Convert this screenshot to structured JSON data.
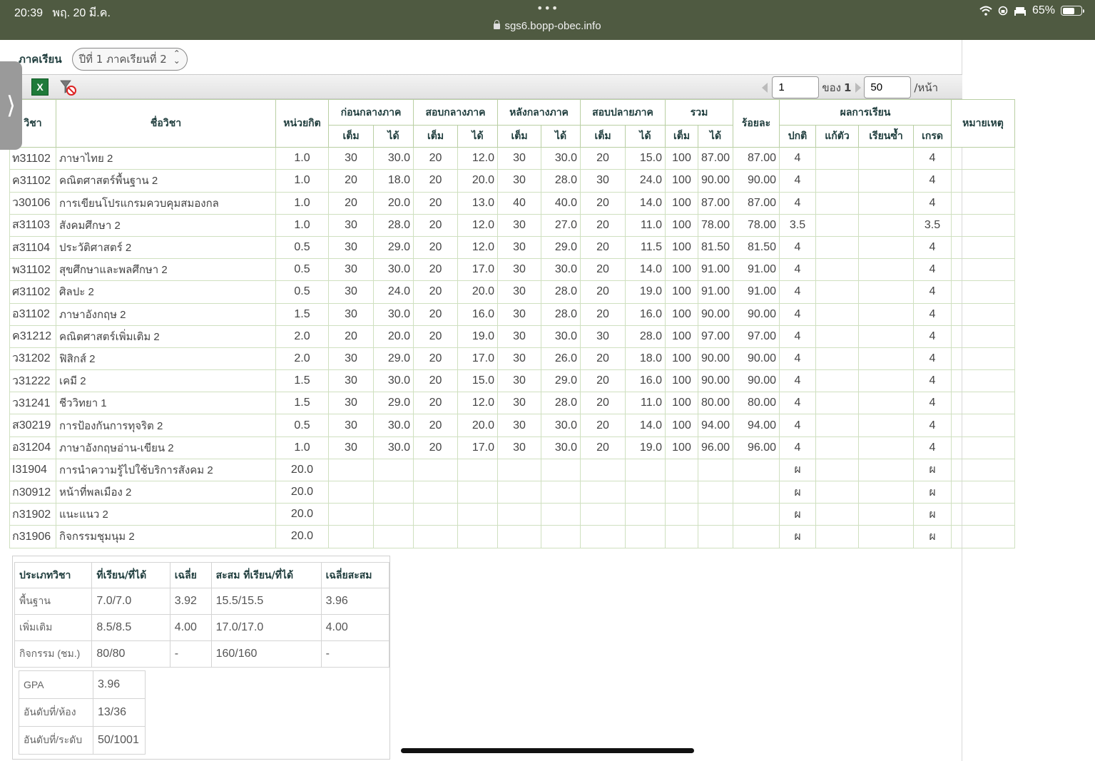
{
  "status_bar": {
    "time": "20:39",
    "date": "พฤ. 20 มี.ค.",
    "dots": "•••",
    "url": "sgs6.bopp-obec.info",
    "battery": "65%",
    "icons": [
      "wifi-icon",
      "rotation-lock-icon",
      "sleep-icon",
      "battery-icon"
    ]
  },
  "side_tab": {
    "glyph": "⟩"
  },
  "term": {
    "label": "ภาคเรียน",
    "selected": "ปีที่ 1 ภาคเรียนที่ 2"
  },
  "toolbar": {
    "excel_icon": "X",
    "pager": {
      "page": "1",
      "of_label": "ของ",
      "total_pages": "1",
      "per_page": "50",
      "per_page_label": "/หน้า"
    }
  },
  "table": {
    "headers": {
      "code": "วิชา",
      "name": "ชื่อวิชา",
      "credit": "หน่วยกิต",
      "groups": [
        "ก่อนกลางภาค",
        "สอบกลางภาค",
        "หลังกลางภาค",
        "สอบปลายภาค",
        "รวม"
      ],
      "full": "เต็ม",
      "got": "ได้",
      "percent": "ร้อยละ",
      "result": "ผลการเรียน",
      "result_cols": [
        "ปกติ",
        "แก้ตัว",
        "เรียนซ้ำ",
        "เกรด"
      ],
      "note": "หมายเหตุ"
    },
    "rows": [
      [
        "ท31102",
        "ภาษาไทย 2",
        "1.0",
        "30",
        "30.0",
        "20",
        "12.0",
        "30",
        "30.0",
        "20",
        "15.0",
        "100",
        "87.00",
        "87.00",
        "4",
        "",
        "",
        "4",
        ""
      ],
      [
        "ค31102",
        "คณิตศาสตร์พื้นฐาน 2",
        "1.0",
        "20",
        "18.0",
        "20",
        "20.0",
        "30",
        "28.0",
        "30",
        "24.0",
        "100",
        "90.00",
        "90.00",
        "4",
        "",
        "",
        "4",
        ""
      ],
      [
        "ว30106",
        "การเขียนโปรแกรมควบคุมสมองกล",
        "1.0",
        "20",
        "20.0",
        "20",
        "13.0",
        "40",
        "40.0",
        "20",
        "14.0",
        "100",
        "87.00",
        "87.00",
        "4",
        "",
        "",
        "4",
        ""
      ],
      [
        "ส31103",
        "สังคมศึกษา 2",
        "1.0",
        "30",
        "28.0",
        "20",
        "12.0",
        "30",
        "27.0",
        "20",
        "11.0",
        "100",
        "78.00",
        "78.00",
        "3.5",
        "",
        "",
        "3.5",
        ""
      ],
      [
        "ส31104",
        "ประวัติศาสตร์ 2",
        "0.5",
        "30",
        "29.0",
        "20",
        "12.0",
        "30",
        "29.0",
        "20",
        "11.5",
        "100",
        "81.50",
        "81.50",
        "4",
        "",
        "",
        "4",
        ""
      ],
      [
        "พ31102",
        "สุขศึกษาและพลศึกษา 2",
        "0.5",
        "30",
        "30.0",
        "20",
        "17.0",
        "30",
        "30.0",
        "20",
        "14.0",
        "100",
        "91.00",
        "91.00",
        "4",
        "",
        "",
        "4",
        ""
      ],
      [
        "ศ31102",
        "ศิลปะ 2",
        "0.5",
        "30",
        "24.0",
        "20",
        "20.0",
        "30",
        "28.0",
        "20",
        "19.0",
        "100",
        "91.00",
        "91.00",
        "4",
        "",
        "",
        "4",
        ""
      ],
      [
        "อ31102",
        "ภาษาอังกฤษ 2",
        "1.5",
        "30",
        "30.0",
        "20",
        "16.0",
        "30",
        "28.0",
        "20",
        "16.0",
        "100",
        "90.00",
        "90.00",
        "4",
        "",
        "",
        "4",
        ""
      ],
      [
        "ค31212",
        "คณิตศาสตร์เพิ่มเติม 2",
        "2.0",
        "20",
        "20.0",
        "20",
        "19.0",
        "30",
        "30.0",
        "30",
        "28.0",
        "100",
        "97.00",
        "97.00",
        "4",
        "",
        "",
        "4",
        ""
      ],
      [
        "ว31202",
        "ฟิสิกส์ 2",
        "2.0",
        "30",
        "29.0",
        "20",
        "17.0",
        "30",
        "26.0",
        "20",
        "18.0",
        "100",
        "90.00",
        "90.00",
        "4",
        "",
        "",
        "4",
        ""
      ],
      [
        "ว31222",
        "เคมี 2",
        "1.5",
        "30",
        "30.0",
        "20",
        "15.0",
        "30",
        "29.0",
        "20",
        "16.0",
        "100",
        "90.00",
        "90.00",
        "4",
        "",
        "",
        "4",
        ""
      ],
      [
        "ว31241",
        "ชีววิทยา 1",
        "1.5",
        "30",
        "29.0",
        "20",
        "12.0",
        "30",
        "28.0",
        "20",
        "11.0",
        "100",
        "80.00",
        "80.00",
        "4",
        "",
        "",
        "4",
        ""
      ],
      [
        "ส30219",
        "การป้องกันการทุจริต 2",
        "0.5",
        "30",
        "30.0",
        "20",
        "20.0",
        "30",
        "30.0",
        "20",
        "14.0",
        "100",
        "94.00",
        "94.00",
        "4",
        "",
        "",
        "4",
        ""
      ],
      [
        "อ31204",
        "ภาษาอังกฤษอ่าน-เขียน 2",
        "1.0",
        "30",
        "30.0",
        "20",
        "17.0",
        "30",
        "30.0",
        "20",
        "19.0",
        "100",
        "96.00",
        "96.00",
        "4",
        "",
        "",
        "4",
        ""
      ],
      [
        "I31904",
        "การนำความรู้ไปใช้บริการสังคม 2",
        "20.0",
        "",
        "",
        "",
        "",
        "",
        "",
        "",
        "",
        "",
        "",
        "",
        "ผ",
        "",
        "",
        "ผ",
        ""
      ],
      [
        "ก30912",
        "หน้าที่พลเมือง 2",
        "20.0",
        "",
        "",
        "",
        "",
        "",
        "",
        "",
        "",
        "",
        "",
        "",
        "ผ",
        "",
        "",
        "ผ",
        ""
      ],
      [
        "ก31902",
        "แนะแนว 2",
        "20.0",
        "",
        "",
        "",
        "",
        "",
        "",
        "",
        "",
        "",
        "",
        "",
        "ผ",
        "",
        "",
        "ผ",
        ""
      ],
      [
        "ก31906",
        "กิจกรรมชุมนุม 2",
        "20.0",
        "",
        "",
        "",
        "",
        "",
        "",
        "",
        "",
        "",
        "",
        "",
        "ผ",
        "",
        "",
        "ผ",
        ""
      ]
    ]
  },
  "summary": {
    "headers": [
      "ประเภทวิชา",
      "ที่เรียน/ที่ได้",
      "เฉลี่ย",
      "สะสม ที่เรียน/ที่ได้",
      "เฉลี่ยสะสม"
    ],
    "rows": [
      [
        "พื้นฐาน",
        "7.0/7.0",
        "3.92",
        "15.5/15.5",
        "3.96"
      ],
      [
        "เพิ่มเติม",
        "8.5/8.5",
        "4.00",
        "17.0/17.0",
        "4.00"
      ],
      [
        "กิจกรรม (ชม.)",
        "80/80",
        "-",
        "160/160",
        "-"
      ]
    ]
  },
  "gpa": [
    [
      "GPA",
      "3.96"
    ],
    [
      "อันดับที่/ห้อง",
      "13/36"
    ],
    [
      "อันดับที่/ระดับ",
      "50/1001"
    ]
  ]
}
